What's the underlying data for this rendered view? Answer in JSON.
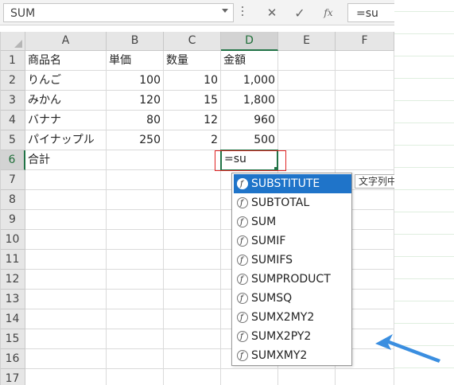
{
  "formula_bar": {
    "name_box": "SUM",
    "cancel_icon": "✕",
    "enter_icon": "✓",
    "fx_icon": "fx",
    "formula": "=su"
  },
  "columns": [
    "A",
    "B",
    "C",
    "D",
    "E",
    "F"
  ],
  "rows": [
    "1",
    "2",
    "3",
    "4",
    "5",
    "6",
    "7",
    "8",
    "9",
    "10",
    "11",
    "12",
    "13",
    "14",
    "15",
    "16",
    "17"
  ],
  "table": {
    "r1": {
      "a": "商品名",
      "b": "単価",
      "c": "数量",
      "d": "金額"
    },
    "r2": {
      "a": "りんご",
      "b": "100",
      "c": "10",
      "d": "1,000"
    },
    "r3": {
      "a": "みかん",
      "b": "120",
      "c": "15",
      "d": "1,800"
    },
    "r4": {
      "a": "バナナ",
      "b": "80",
      "c": "12",
      "d": "960"
    },
    "r5": {
      "a": "パイナップル",
      "b": "250",
      "c": "2",
      "d": "500"
    },
    "r6": {
      "a": "合計",
      "d": "=su"
    }
  },
  "autocomplete": {
    "items": [
      "SUBSTITUTE",
      "SUBTOTAL",
      "SUM",
      "SUMIF",
      "SUMIFS",
      "SUMPRODUCT",
      "SUMSQ",
      "SUMX2MY2",
      "SUMX2PY2",
      "SUMXMY2"
    ],
    "selected": "SUBSTITUTE",
    "tooltip": "文字列中"
  },
  "colors": {
    "accent_green": "#217346",
    "selection_blue": "#1f74c9",
    "highlight_red": "#e02424",
    "arrow_blue": "#3a8ee0"
  }
}
